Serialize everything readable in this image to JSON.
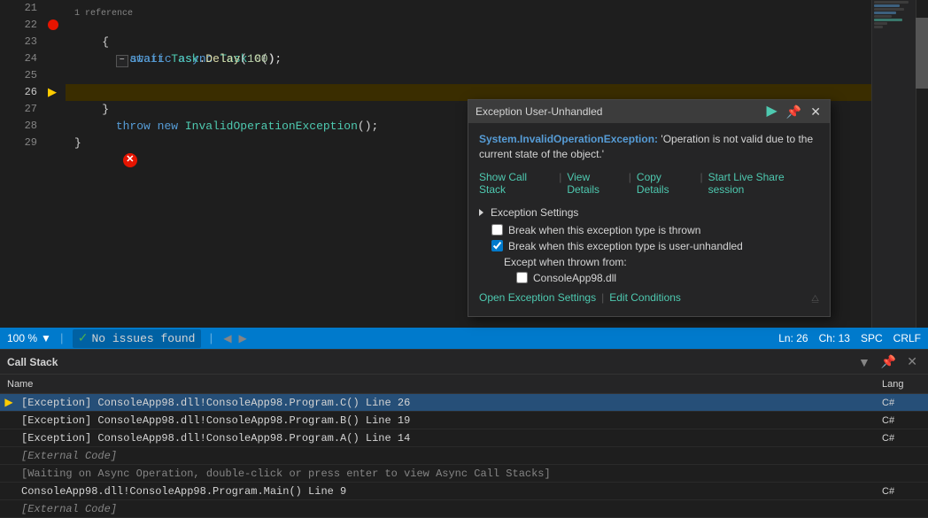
{
  "editor": {
    "lines": [
      {
        "num": "21",
        "content": "",
        "type": "normal"
      },
      {
        "num": "22",
        "content": "    static async Task C()",
        "type": "normal",
        "has_fold": true,
        "ref": "1 reference"
      },
      {
        "num": "23",
        "content": "    {",
        "type": "normal"
      },
      {
        "num": "24",
        "content": "        await Task.Delay(100);",
        "type": "normal"
      },
      {
        "num": "25",
        "content": "",
        "type": "normal"
      },
      {
        "num": "26",
        "content": "        throw new InvalidOperationException();",
        "type": "highlighted",
        "has_breakpoint": true,
        "has_arrow": true
      },
      {
        "num": "27",
        "content": "    }",
        "type": "normal"
      },
      {
        "num": "28",
        "content": "",
        "type": "normal"
      },
      {
        "num": "29",
        "content": "}",
        "type": "normal"
      }
    ]
  },
  "exception_popup": {
    "title": "Exception User-Unhandled",
    "message_prefix": "System.InvalidOperationException:",
    "message_text": " 'Operation is not valid due to the current state of the object.'",
    "links": [
      {
        "label": "Show Call Stack"
      },
      {
        "label": "View Details"
      },
      {
        "label": "Copy Details"
      },
      {
        "label": "Start Live Share session"
      }
    ],
    "settings_header": "Exception Settings",
    "checkbox1_label": "Break when this exception type is thrown",
    "checkbox1_checked": false,
    "checkbox2_label": "Break when this exception type is user-unhandled",
    "checkbox2_checked": true,
    "except_when_label": "Except when thrown from:",
    "console_dll_label": "ConsoleApp98.dll",
    "console_dll_checked": false,
    "open_settings_label": "Open Exception Settings",
    "edit_conditions_label": "Edit Conditions"
  },
  "status_bar": {
    "zoom": "100 %",
    "no_issues": "No issues found",
    "ln": "Ln: 26",
    "ch": "Ch: 13",
    "encoding": "SPC",
    "line_ending": "CRLF"
  },
  "call_stack": {
    "title": "Call Stack",
    "col_name": "Name",
    "col_lang": "Lang",
    "rows": [
      {
        "arrow": true,
        "name": "[Exception] ConsoleApp98.dll!ConsoleApp98.Program.C() Line 26",
        "lang": "C#",
        "selected": true
      },
      {
        "arrow": false,
        "name": "[Exception] ConsoleApp98.dll!ConsoleApp98.Program.B() Line 19",
        "lang": "C#",
        "selected": false
      },
      {
        "arrow": false,
        "name": "[Exception] ConsoleApp98.dll!ConsoleApp98.Program.A() Line 14",
        "lang": "C#",
        "selected": false
      },
      {
        "arrow": false,
        "name": "[External Code]",
        "lang": "",
        "selected": false,
        "external": true
      },
      {
        "arrow": false,
        "name": "[Waiting on Async Operation, double-click or press enter to view Async Call Stacks]",
        "lang": "",
        "selected": false,
        "async": true
      },
      {
        "arrow": false,
        "name": "ConsoleApp98.dll!ConsoleApp98.Program.Main() Line 9",
        "lang": "C#",
        "selected": false
      },
      {
        "arrow": false,
        "name": "[External Code]",
        "lang": "",
        "selected": false,
        "external": true
      }
    ]
  }
}
